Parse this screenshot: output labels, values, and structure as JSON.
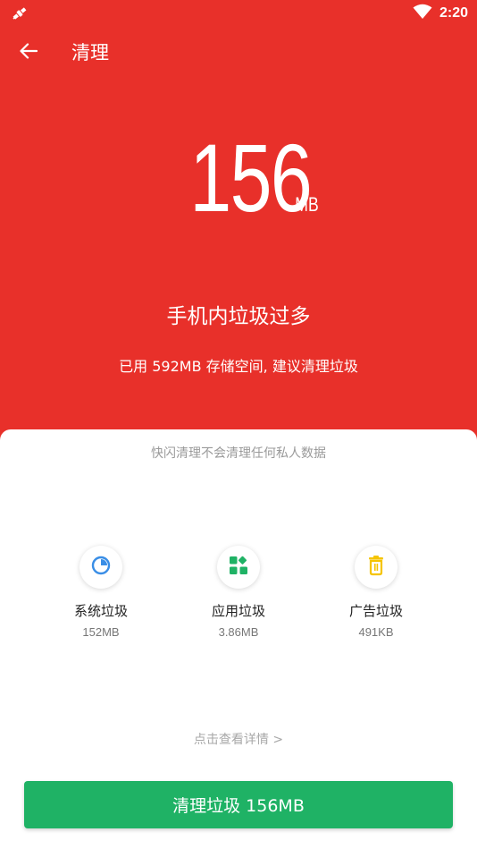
{
  "status_bar": {
    "time": "2:20"
  },
  "app_bar": {
    "title": "清理"
  },
  "summary": {
    "junk_size": "156",
    "junk_unit": "MB",
    "headline": "手机内垃圾过多",
    "subline": "已用 592MB 存储空间, 建议清理垃圾"
  },
  "card": {
    "privacy_note": "快闪清理不会清理任何私人数据",
    "categories": [
      {
        "name": "系统垃圾",
        "size": "152MB",
        "icon": "pie-chart-icon",
        "color": "#3a8ee6"
      },
      {
        "name": "应用垃圾",
        "size": "3.86MB",
        "icon": "apps-grid-icon",
        "color": "#1fb265"
      },
      {
        "name": "广告垃圾",
        "size": "491KB",
        "icon": "trash-icon",
        "color": "#f5c400"
      }
    ],
    "details_link": "点击查看详情 >",
    "clean_button": "清理垃圾 156MB"
  },
  "colors": {
    "accent_red": "#e8302a",
    "button_green": "#1fb265"
  }
}
